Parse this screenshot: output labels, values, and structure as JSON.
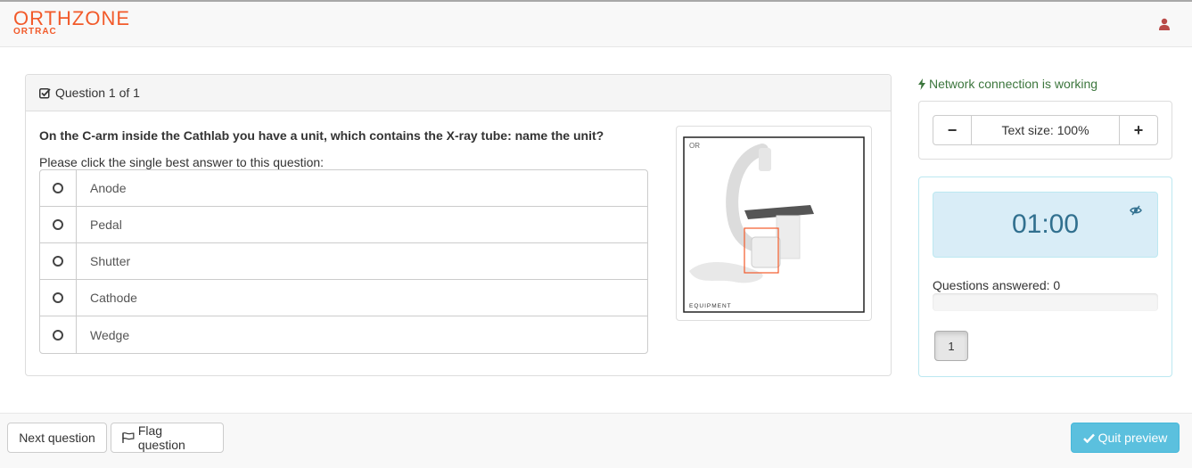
{
  "header": {
    "logo_main": "ORTHZONE",
    "logo_sub": "ORTRAC",
    "user_icon": "user-icon"
  },
  "question": {
    "heading": "Question 1 of 1",
    "text": "On the C-arm inside the Cathlab you have a unit, which contains the X-ray tube: name the unit?",
    "instruction": "Please click the single best answer to this question:",
    "answers": [
      "Anode",
      "Pedal",
      "Shutter",
      "Cathode",
      "Wedge"
    ],
    "image_caption": "EQUIPMENT"
  },
  "sidebar": {
    "network_status": "Network connection is working",
    "text_size_label": "Text size: 100%",
    "minus_label": "−",
    "plus_label": "+",
    "timer": "01:00",
    "answered_label": "Questions answered: 0",
    "answered_progress": 0,
    "question_numbers": [
      "1"
    ]
  },
  "footer": {
    "next_label": "Next question",
    "flag_label": "Flag question",
    "quit_label": "Quit preview"
  },
  "colors": {
    "brand": "#f25a2a",
    "success": "#3c763d",
    "info": "#31708f",
    "quit": "#5bc0de"
  }
}
